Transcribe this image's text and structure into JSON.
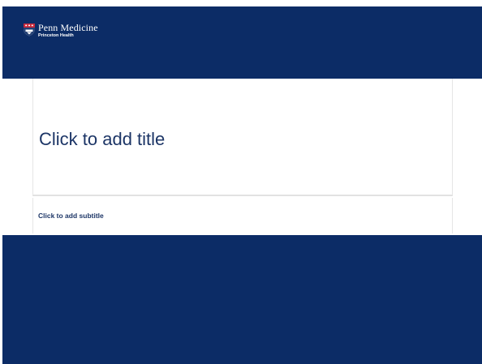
{
  "brand": {
    "name": "Penn Medicine",
    "subname": "Princeton Health",
    "color": "#0c2c66",
    "logo_icon": "penn-shield-icon"
  },
  "slide": {
    "title_placeholder": "Click to add title",
    "subtitle_placeholder": "Click to add subtitle",
    "text_color": "#1c3566"
  }
}
